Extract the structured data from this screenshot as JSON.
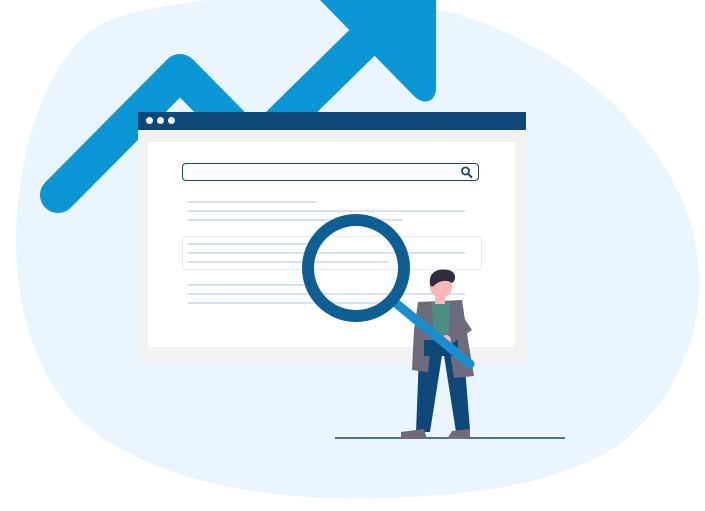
{
  "illustration": {
    "colors": {
      "blob": "#eaf5fe",
      "arrow": "#0b97d5",
      "window_titlebar": "#0d4878",
      "window_frame": "#f2f2f2",
      "content_bg": "#ffffff",
      "text_lines": "#d7e2ec",
      "magnifier_ring": "#0d5f93",
      "magnifier_handle": "#1a8fd0",
      "person_hair": "#2f2e41",
      "person_skin": "#ffb6b6",
      "person_jacket": "#6f6b7d",
      "person_shirt": "#4a8f82",
      "person_pants": "#0d4878",
      "ground_line": "#0d4878"
    },
    "icons": [
      "trend-arrow-icon",
      "search-icon",
      "magnifying-glass-icon"
    ]
  }
}
